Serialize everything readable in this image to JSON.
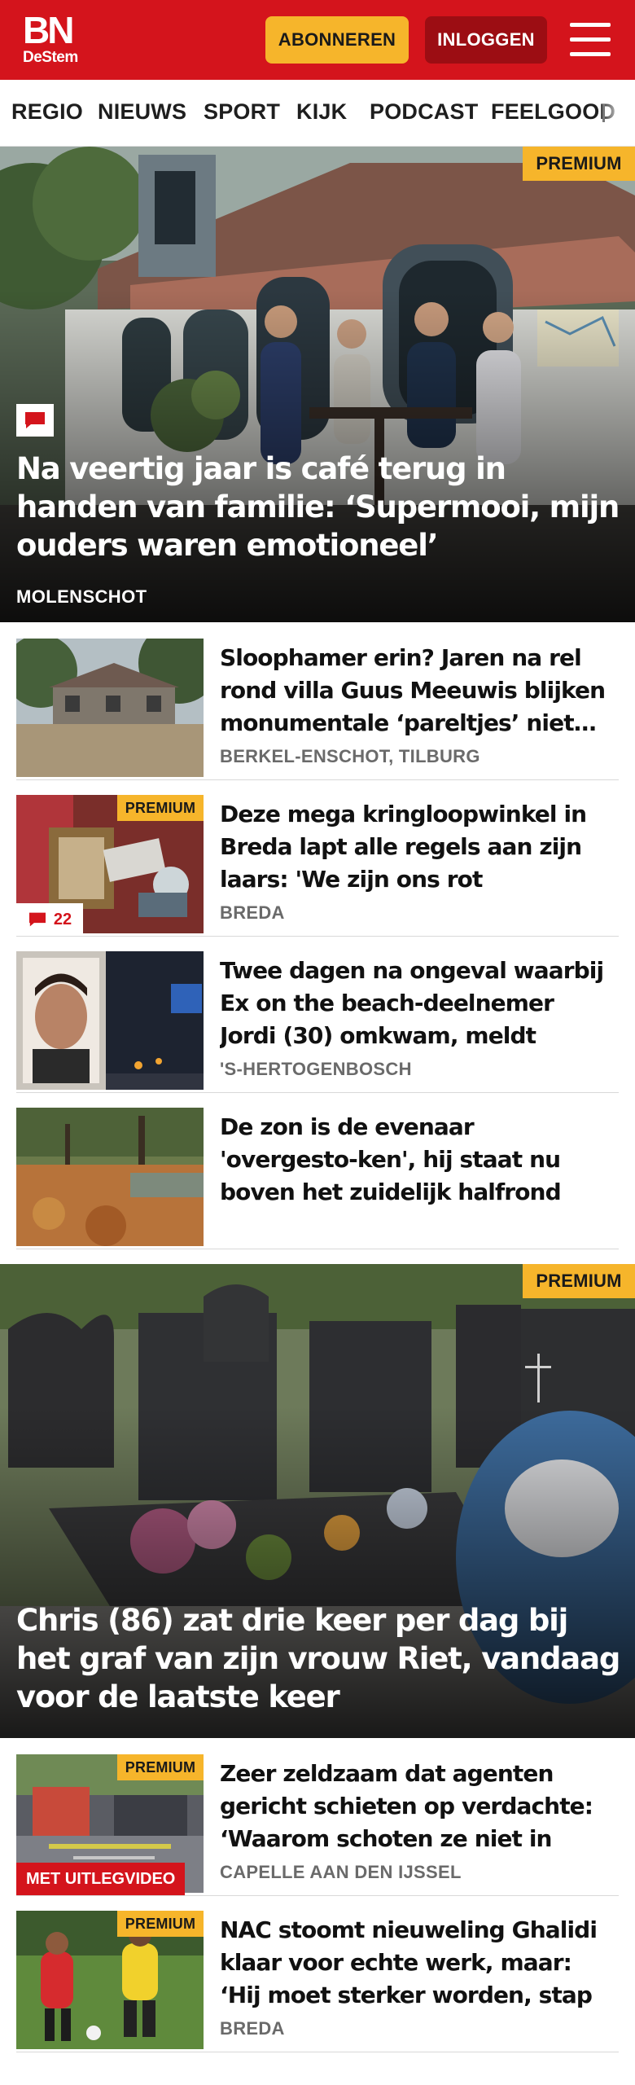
{
  "header": {
    "logo_main": "BN",
    "logo_sub": "DeStem",
    "subscribe_label": "ABONNEREN",
    "login_label": "INLOGGEN"
  },
  "nav": {
    "items": [
      "REGIO",
      "NIEUWS",
      "SPORT",
      "KIJK",
      "PODCAST",
      "FEELGOOD"
    ]
  },
  "colors": {
    "brand_red": "#d4141c",
    "premium_yellow": "#f6b52b",
    "login_dark_red": "#9c0d13"
  },
  "hero1": {
    "premium": "PREMIUM",
    "title": "Na veertig jaar is café terug in handen van familie: ‘Supermooi, mijn ouders waren emotioneel’",
    "location": "MOLENSCHOT",
    "icon": "comment-icon"
  },
  "articles": [
    {
      "headline": "Sloophamer erin? Jaren na rel rond villa Guus Meeuwis blijken monumentale ‘pareltjes’ niet…",
      "place": "BERKEL-ENSCHOT, TILBURG"
    },
    {
      "headline": "Deze mega kringloopwinkel in Breda lapt alle regels aan zijn laars: 'We zijn ons rot geschrok-…",
      "place": "BREDA",
      "premium": "PREMIUM",
      "comments": "22"
    },
    {
      "headline": "Twee dagen na ongeval waarbij Ex on the beach-deelnemer Jordi (30) omkwam, meldt bestuurde…",
      "place": "'S-HERTOGENBOSCH"
    },
    {
      "headline": "De zon is de evenaar 'overgesto-ken', hij staat nu boven het zuidelijk halfrond",
      "place": ""
    }
  ],
  "hero2": {
    "premium": "PREMIUM",
    "title": "Chris (86) zat drie keer per dag bij het graf van zijn vrouw Riet, vandaag voor de laatste keer"
  },
  "articles2": [
    {
      "headline": "Zeer zeldzaam dat agenten gericht schieten op verdachte: ‘Waarom schoten ze niet in bee…",
      "place": "CAPELLE AAN DEN IJSSEL",
      "premium": "PREMIUM",
      "badge": "MET UITLEGVIDEO"
    },
    {
      "headline": "NAC stoomt nieuweling Ghalidi klaar voor echte werk, maar: ‘Hij moet sterker worden, stap voor…",
      "place": "BREDA",
      "premium": "PREMIUM"
    }
  ]
}
